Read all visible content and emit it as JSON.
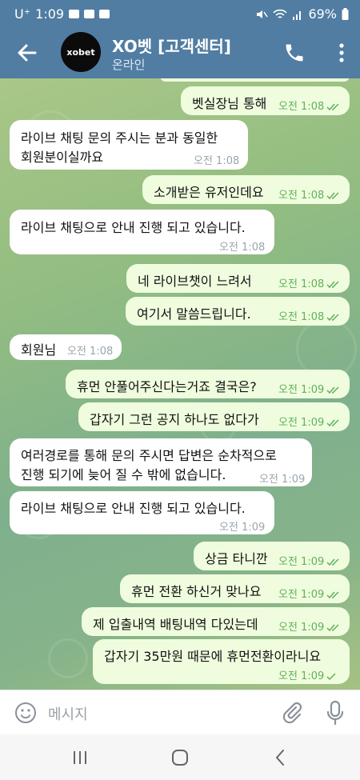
{
  "status_bar": {
    "time": "1:09",
    "carrier": "U⁺",
    "battery": "69%"
  },
  "header": {
    "title": "XO벳 [고객센터]",
    "subtitle": "온라인",
    "avatar_text": "xobet"
  },
  "messages": [
    {
      "dir": "out",
      "text": "벳실장님 통해",
      "time": "오전 1:08"
    },
    {
      "dir": "in",
      "text": "라이브 채팅 문의 주시는 분과 동일한",
      "text2": "회원분이실까요",
      "time": "오전 1:08"
    },
    {
      "dir": "out",
      "text": "소개받은 유저인데요",
      "time": "오전 1:08"
    },
    {
      "dir": "in",
      "text": "라이브 채팅으로 안내 진행 되고 있습니다.",
      "time": "오전 1:08"
    },
    {
      "dir": "out",
      "text": "네 라이브챗이 느려서",
      "time": "오전 1:08"
    },
    {
      "dir": "out",
      "text": "여기서 말씀드립니다.",
      "time": "오전 1:08"
    },
    {
      "dir": "in",
      "text": "회원님",
      "time": "오전 1:08"
    },
    {
      "dir": "out",
      "text": "휴먼 안풀어주신다는거죠 결국은?",
      "time": "오전 1:09"
    },
    {
      "dir": "out",
      "text": "갑자기 그런 공지 하나도 없다가",
      "time": "오전 1:09"
    },
    {
      "dir": "in",
      "text": "여러경로를 통해 문의 주시면 답변은 순차적으로",
      "text2": "진행 되기에 늦어 질 수 밖에 없습니다.",
      "time": "오전 1:09"
    },
    {
      "dir": "in",
      "text": "라이브 채팅으로 안내 진행 되고 있습니다.",
      "time": "오전 1:09"
    },
    {
      "dir": "out",
      "text": "상금 타니깐",
      "time": "오전 1:09"
    },
    {
      "dir": "out",
      "text": "휴먼 전환 하신거 맞나요",
      "time": "오전 1:09"
    },
    {
      "dir": "out",
      "text": "제 입출내역 배팅내역 다있는데",
      "time": "오전 1:09"
    },
    {
      "dir": "out",
      "text": "갑자기 35만원 때문에 휴먼전환이라니요",
      "time": "오전 1:09"
    }
  ],
  "input": {
    "placeholder": "메시지"
  },
  "colors": {
    "header": "#517da2",
    "out_bubble": "#effdde",
    "in_bubble": "#ffffff",
    "check": "#5fb05a"
  },
  "icons": [
    "back-arrow-icon",
    "phone-icon",
    "more-vert-icon",
    "emoji-icon",
    "attach-icon",
    "mic-icon",
    "recents-icon",
    "home-icon",
    "back-nav-icon"
  ]
}
